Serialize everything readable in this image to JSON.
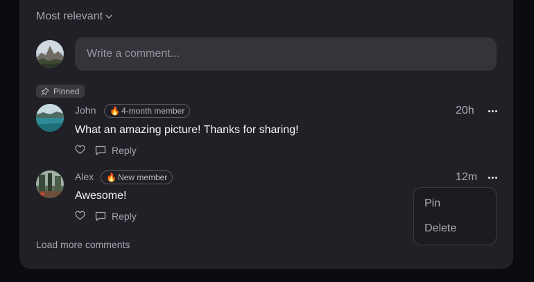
{
  "sort": {
    "label": "Most relevant",
    "icon": "chevron-down-icon"
  },
  "composer": {
    "placeholder": "Write a comment..."
  },
  "pinned_label": "Pinned",
  "comments": [
    {
      "author": "John",
      "badge": "4-month member",
      "time": "20h",
      "text": "What an amazing picture! Thanks for sharing!",
      "reply_label": "Reply",
      "pinned": true
    },
    {
      "author": "Alex",
      "badge": "New member",
      "time": "12m",
      "text": "Awesome!",
      "reply_label": "Reply",
      "pinned": false
    }
  ],
  "context_menu": {
    "items": [
      "Pin",
      "Delete"
    ]
  },
  "load_more_label": "Load more comments",
  "colors": {
    "background": "#0b0b12",
    "panel": "#212027",
    "input": "#35343b",
    "muted_text": "#a9a8b1",
    "text": "#f4f4f6"
  }
}
